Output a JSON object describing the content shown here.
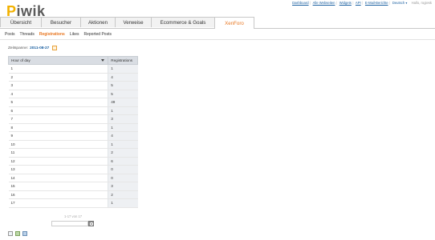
{
  "logo": {
    "p": "P",
    "rest": "iwik"
  },
  "toplinks": {
    "items": [
      "Dashboard",
      "Alle Webseiten",
      "Widgets",
      "API",
      "E-Mail-Berichte"
    ],
    "language": "Deutsch ▾",
    "greeting": "Hallo, rogiesk"
  },
  "tabs": [
    "Übersicht",
    "Besucher",
    "Aktionen",
    "Verweise",
    "Ecommerce & Goals",
    "XenForo"
  ],
  "subtabs": [
    "Posts",
    "Threads",
    "Registrations",
    "Likes",
    "Reported Posts"
  ],
  "period": {
    "label": "Zeitspanne:",
    "date": "2011-08-27"
  },
  "table": {
    "headers": [
      "Hour of day",
      "Registrations"
    ],
    "rows": [
      [
        "1",
        "1"
      ],
      [
        "2",
        "4"
      ],
      [
        "3",
        "5"
      ],
      [
        "4",
        "5"
      ],
      [
        "5",
        "49"
      ],
      [
        "6",
        "1"
      ],
      [
        "7",
        "3"
      ],
      [
        "8",
        "1"
      ],
      [
        "9",
        "4"
      ],
      [
        "10",
        "1"
      ],
      [
        "11",
        "2"
      ],
      [
        "12",
        "6"
      ],
      [
        "13",
        "0"
      ],
      [
        "14",
        "0"
      ],
      [
        "15",
        "3"
      ],
      [
        "16",
        "2"
      ],
      [
        "17",
        "1"
      ]
    ]
  },
  "pagination": {
    "text": "1-17 von 17"
  },
  "colors": {
    "accent": "#e87722",
    "link": "#1a5fa0",
    "logo_yellow": "#f2b100"
  }
}
